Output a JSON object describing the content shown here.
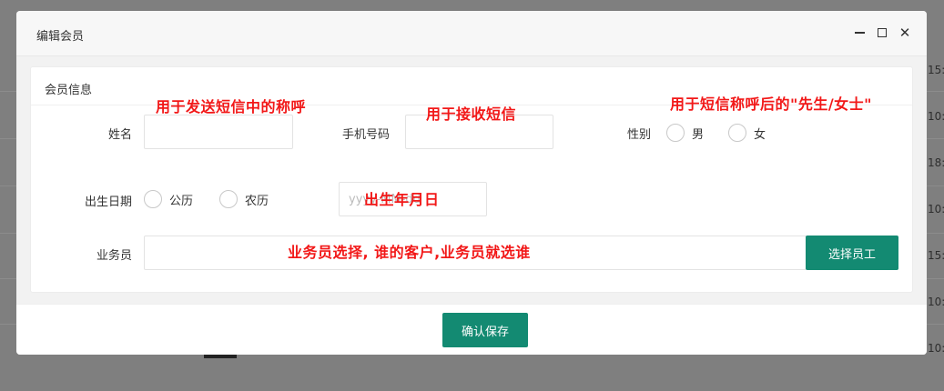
{
  "background": {
    "times": [
      "15:",
      "10:",
      "18:",
      "10:",
      "15:",
      "10:",
      "10:"
    ]
  },
  "modal": {
    "title": "编辑会员",
    "minimize_symbol": "",
    "close_symbol": "✕"
  },
  "card": {
    "title": "会员信息"
  },
  "form": {
    "name_label": "姓名",
    "name_value": "",
    "phone_label": "手机号码",
    "phone_value": "",
    "gender_label": "性别",
    "gender_options": [
      "男",
      "女"
    ],
    "birth_label": "出生日期",
    "calendar_options": [
      "公历",
      "农历"
    ],
    "birth_placeholder": "yyyy-MM-dd",
    "salesperson_label": "业务员",
    "salesperson_value": "",
    "select_staff_button": "选择员工"
  },
  "annotations": {
    "name_note": "用于发送短信中的称呼",
    "phone_note": "用于接收短信",
    "gender_note": "用于短信称呼后的\"先生/女士\"",
    "birth_note": "出生年月日",
    "salesperson_note": "业务员选择, 谁的客户,业务员就选谁"
  },
  "footer": {
    "save_button": "确认保存"
  },
  "colors": {
    "primary": "#138a72",
    "annotation": "#f21818"
  }
}
